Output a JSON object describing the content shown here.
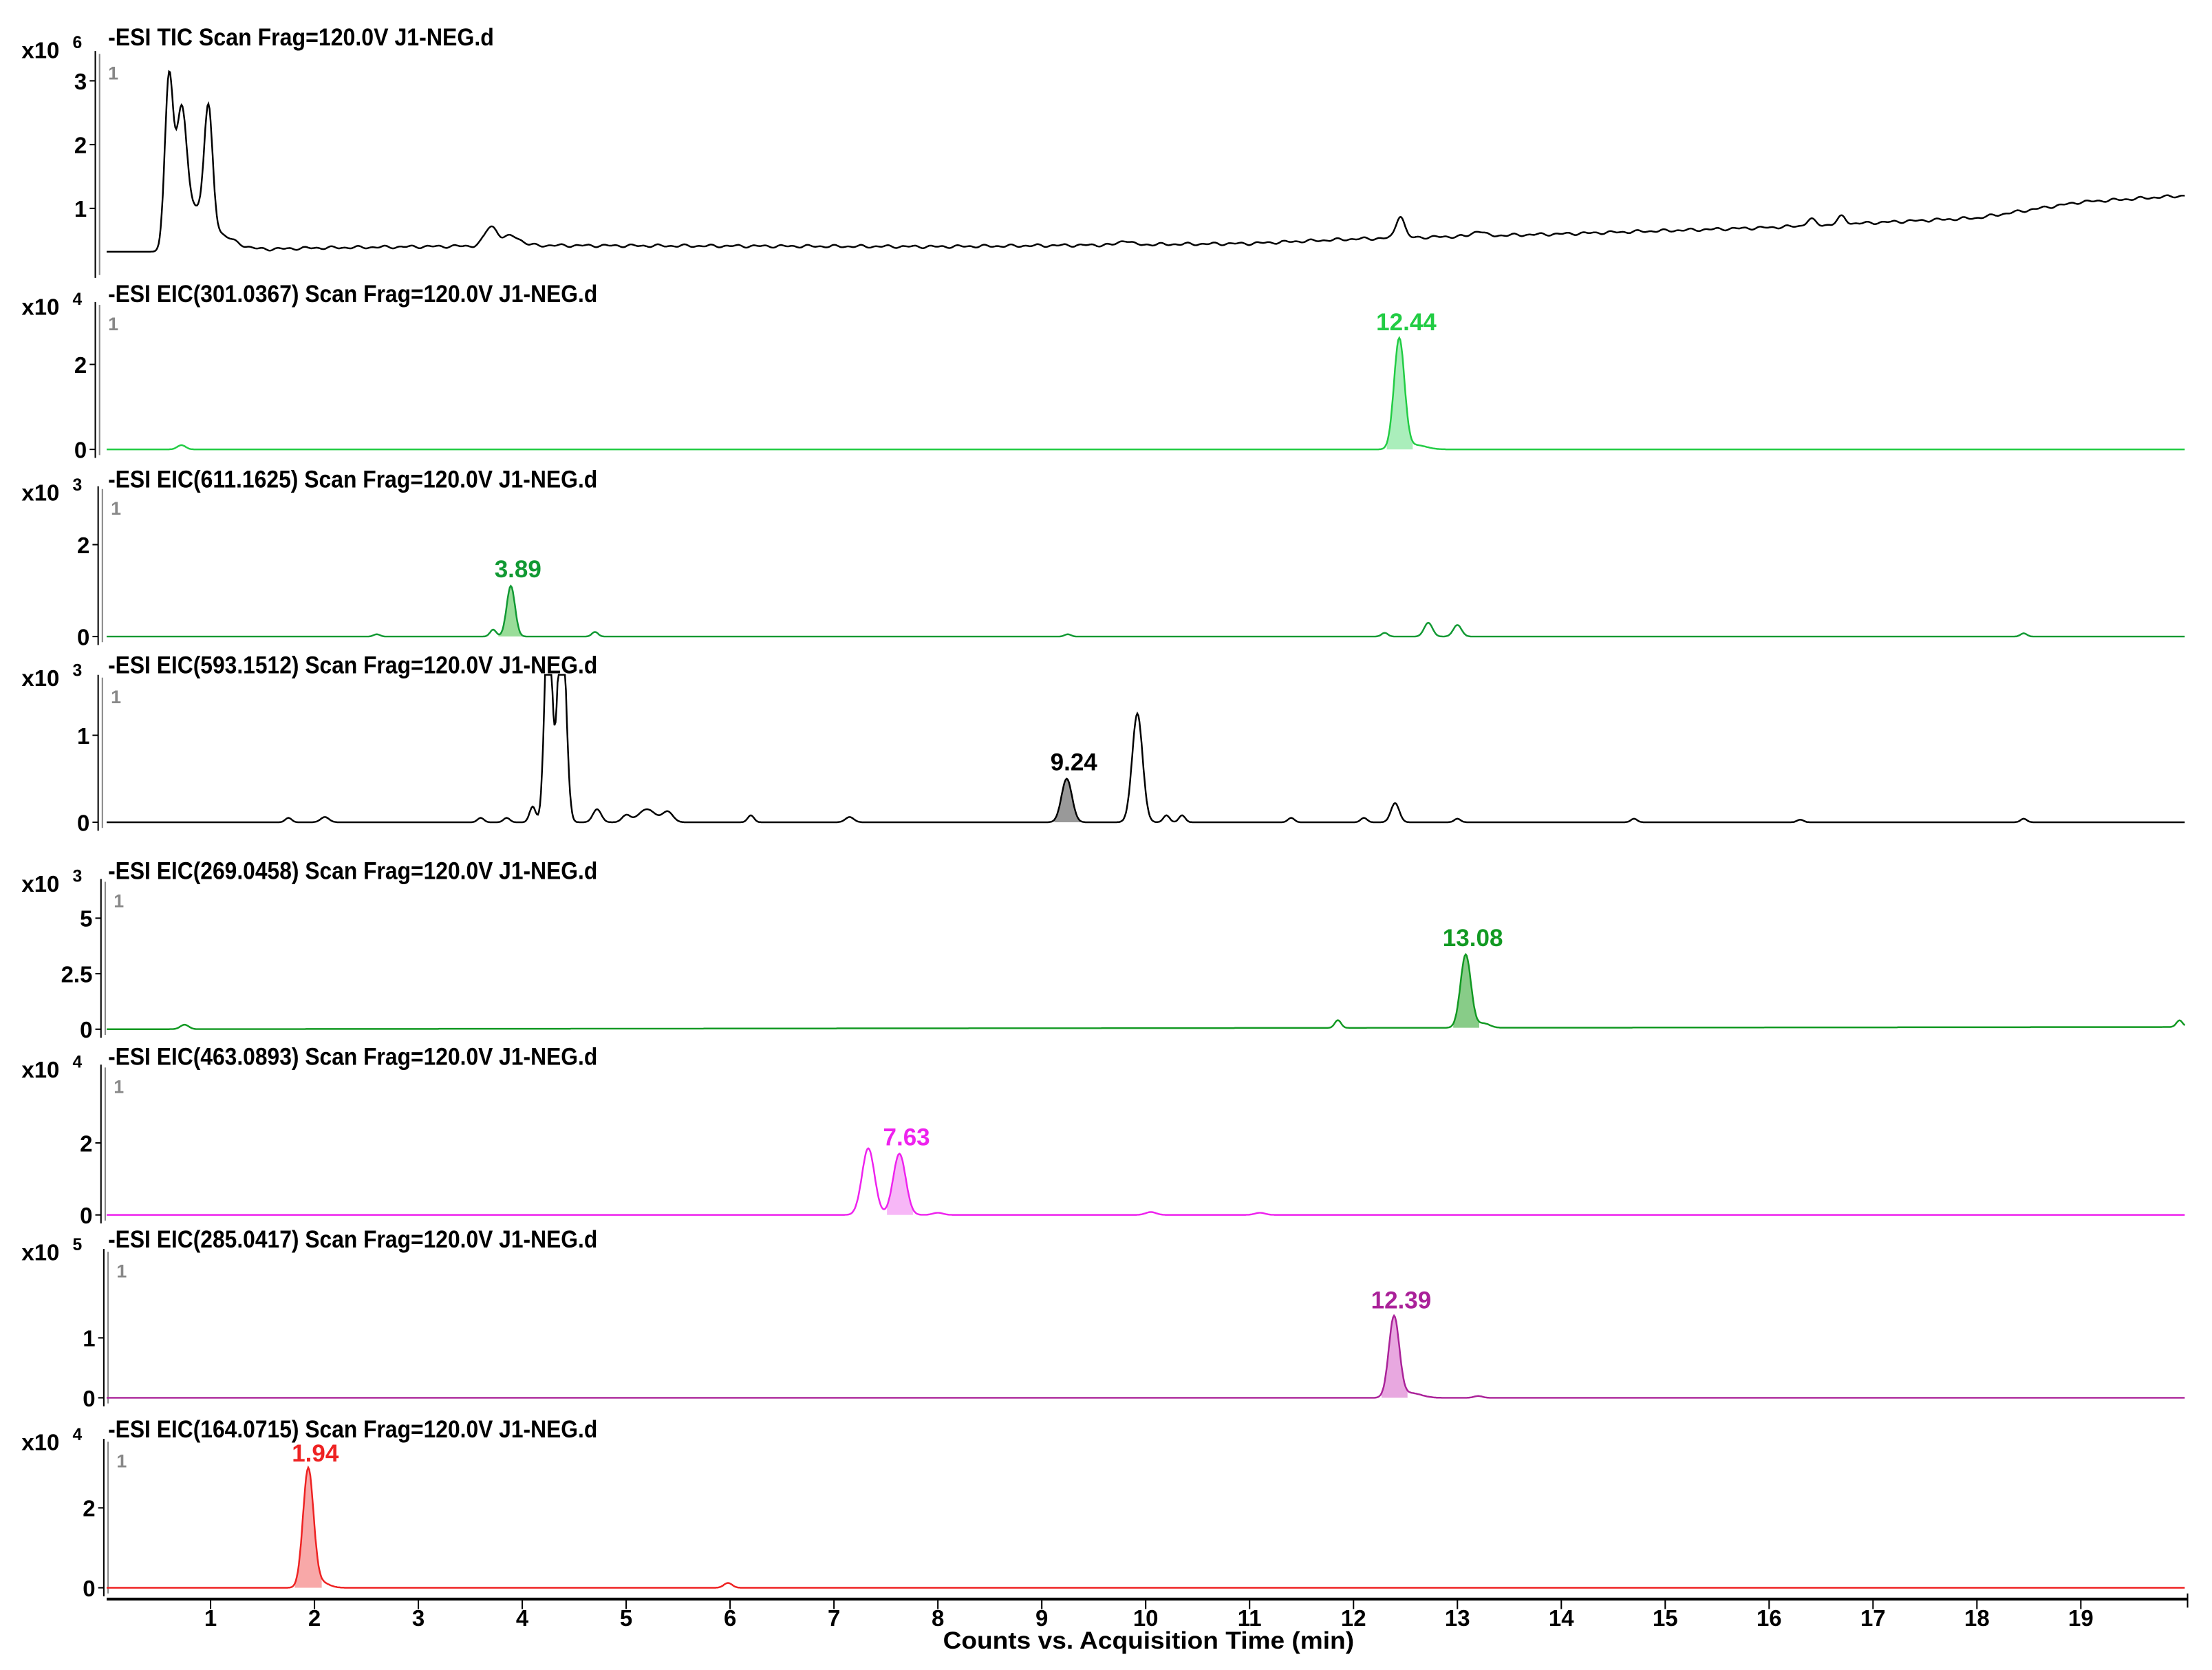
{
  "chart_data": {
    "type": "line",
    "xlabel": "Counts vs. Acquisition Time (min)",
    "xlim": [
      0,
      20
    ],
    "xticks": [
      "1",
      "2",
      "3",
      "4",
      "5",
      "6",
      "7",
      "8",
      "9",
      "10",
      "11",
      "12",
      "13",
      "14",
      "15",
      "16",
      "17",
      "18",
      "19"
    ],
    "panels": [
      {
        "title": "-ESI TIC Scan Frag=120.0V J1-NEG.d",
        "multiplier": "x10",
        "exponent": "6",
        "index_label": "1",
        "color": "#000000",
        "fill": "#bbbbbb",
        "ylim": [
          0,
          3.2
        ],
        "yticks": [
          "1",
          "2",
          "3"
        ],
        "ytick_values": [
          1,
          2,
          3
        ],
        "baseline": [
          [
            0,
            0.32
          ],
          [
            0.55,
            0.32
          ],
          [
            2,
            0.38
          ],
          [
            4,
            0.42
          ],
          [
            8,
            0.4
          ],
          [
            11,
            0.45
          ],
          [
            12,
            0.52
          ],
          [
            14,
            0.6
          ],
          [
            16,
            0.7
          ],
          [
            18,
            0.85
          ],
          [
            19,
            1.1
          ],
          [
            20,
            1.2
          ]
        ],
        "peaks": [
          [
            0.6,
            2.65,
            0.04
          ],
          [
            0.72,
            1.9,
            0.05
          ],
          [
            0.85,
            0.6,
            0.12
          ],
          [
            0.98,
            1.8,
            0.04
          ],
          [
            1.1,
            0.2,
            0.15
          ],
          [
            3.7,
            0.3,
            0.06
          ],
          [
            3.9,
            0.15,
            0.08
          ],
          [
            9.8,
            0.07,
            0.05
          ],
          [
            12.45,
            0.35,
            0.04
          ],
          [
            13.2,
            0.08,
            0.05
          ],
          [
            16.4,
            0.1,
            0.04
          ],
          [
            16.7,
            0.12,
            0.04
          ]
        ],
        "annotation": null
      },
      {
        "title": "-ESI EIC(301.0367) Scan Frag=120.0V J1-NEG.d",
        "multiplier": "x10",
        "exponent": "4",
        "index_label": "1",
        "color": "#22cc44",
        "fill": "#aaeebb",
        "ylim": [
          0,
          3.07
        ],
        "yticks": [
          "0",
          "2"
        ],
        "ytick_values": [
          0,
          2
        ],
        "baseline": [
          [
            0,
            0
          ],
          [
            20,
            0
          ]
        ],
        "peaks": [
          [
            0.72,
            0.1,
            0.04
          ],
          [
            12.44,
            2.6,
            0.05
          ],
          [
            12.6,
            0.1,
            0.1
          ]
        ],
        "annotation": {
          "label": "12.44",
          "x": 12.44,
          "color": "#22cc44",
          "shaded": 12.44
        }
      },
      {
        "title": "-ESI EIC(611.1625) Scan Frag=120.0V J1-NEG.d",
        "multiplier": "x10",
        "exponent": "3",
        "index_label": "1",
        "color": "#119933",
        "fill": "#99dd99",
        "ylim": [
          0,
          2.9
        ],
        "yticks": [
          "0",
          "2"
        ],
        "ytick_values": [
          0,
          2
        ],
        "baseline": [
          [
            0,
            0
          ],
          [
            20,
            0
          ]
        ],
        "peaks": [
          [
            2.6,
            0.05,
            0.03
          ],
          [
            3.72,
            0.15,
            0.03
          ],
          [
            3.89,
            1.1,
            0.04
          ],
          [
            4.7,
            0.1,
            0.03
          ],
          [
            9.25,
            0.05,
            0.03
          ],
          [
            12.3,
            0.08,
            0.03
          ],
          [
            12.72,
            0.3,
            0.04
          ],
          [
            13.0,
            0.25,
            0.04
          ],
          [
            18.45,
            0.07,
            0.03
          ]
        ],
        "annotation": {
          "label": "3.89",
          "x": 3.89,
          "color": "#119933",
          "shaded": 3.89
        }
      },
      {
        "title": "-ESI EIC(593.1512) Scan Frag=120.0V J1-NEG.d",
        "multiplier": "x10",
        "exponent": "3",
        "index_label": "1",
        "color": "#000000",
        "fill": "#999999",
        "ylim": [
          0,
          1.5
        ],
        "yticks": [
          "0",
          "1"
        ],
        "ytick_values": [
          0,
          1
        ],
        "baseline": [
          [
            0,
            0
          ],
          [
            20,
            0
          ]
        ],
        "peaks": [
          [
            1.75,
            0.05,
            0.03
          ],
          [
            2.1,
            0.06,
            0.04
          ],
          [
            3.6,
            0.05,
            0.03
          ],
          [
            3.85,
            0.05,
            0.03
          ],
          [
            4.1,
            0.18,
            0.03
          ],
          [
            4.25,
            2.5,
            0.035
          ],
          [
            4.38,
            2.5,
            0.04
          ],
          [
            4.72,
            0.15,
            0.04
          ],
          [
            5.0,
            0.08,
            0.04
          ],
          [
            5.2,
            0.15,
            0.08
          ],
          [
            5.4,
            0.12,
            0.05
          ],
          [
            6.2,
            0.08,
            0.03
          ],
          [
            7.15,
            0.06,
            0.04
          ],
          [
            9.24,
            0.5,
            0.05
          ],
          [
            9.92,
            1.25,
            0.05
          ],
          [
            10.2,
            0.08,
            0.03
          ],
          [
            10.35,
            0.08,
            0.03
          ],
          [
            11.4,
            0.05,
            0.03
          ],
          [
            12.1,
            0.05,
            0.03
          ],
          [
            12.4,
            0.22,
            0.04
          ],
          [
            13.0,
            0.04,
            0.03
          ],
          [
            14.7,
            0.04,
            0.03
          ],
          [
            16.3,
            0.03,
            0.03
          ],
          [
            18.45,
            0.04,
            0.03
          ]
        ],
        "annotation": {
          "label": "9.24",
          "x": 9.24,
          "color": "#000000",
          "shaded": 9.24
        }
      },
      {
        "title": "-ESI EIC(269.0458) Scan Frag=120.0V J1-NEG.d",
        "multiplier": "x10",
        "exponent": "3",
        "index_label": "1",
        "color": "#119922",
        "fill": "#88cc88",
        "ylim": [
          0,
          6
        ],
        "yticks": [
          "0",
          "2.5",
          "5"
        ],
        "ytick_values": [
          0,
          2.5,
          5
        ],
        "baseline": [
          [
            0,
            0
          ],
          [
            20,
            0.1
          ]
        ],
        "peaks": [
          [
            0.75,
            0.2,
            0.04
          ],
          [
            11.85,
            0.35,
            0.03
          ],
          [
            13.08,
            3.3,
            0.05
          ],
          [
            13.25,
            0.2,
            0.06
          ],
          [
            19.95,
            0.3,
            0.03
          ]
        ],
        "annotation": {
          "label": "13.08",
          "x": 13.08,
          "color": "#119922",
          "shaded": 13.08
        }
      },
      {
        "title": "-ESI EIC(463.0893) Scan Frag=120.0V J1-NEG.d",
        "multiplier": "x10",
        "exponent": "4",
        "index_label": "1",
        "color": "#ee22ee",
        "fill": "#f7b7f7",
        "ylim": [
          0,
          3.7
        ],
        "yticks": [
          "0",
          "2"
        ],
        "ytick_values": [
          0,
          2
        ],
        "baseline": [
          [
            0,
            0
          ],
          [
            20,
            0
          ]
        ],
        "peaks": [
          [
            7.33,
            1.85,
            0.06
          ],
          [
            7.63,
            1.7,
            0.06
          ],
          [
            8.0,
            0.06,
            0.05
          ],
          [
            10.05,
            0.08,
            0.05
          ],
          [
            11.1,
            0.06,
            0.05
          ]
        ],
        "annotation": {
          "label": "7.63",
          "x": 7.63,
          "color": "#ee22ee",
          "shaded": 7.63
        }
      },
      {
        "title": "-ESI EIC(285.0417) Scan Frag=120.0V J1-NEG.d",
        "multiplier": "x10",
        "exponent": "5",
        "index_label": "1",
        "color": "#aa2299",
        "fill": "#e8a8e0",
        "ylim": [
          0,
          2.2
        ],
        "yticks": [
          "0",
          "1"
        ],
        "ytick_values": [
          0,
          1
        ],
        "baseline": [
          [
            0,
            0
          ],
          [
            20,
            0
          ]
        ],
        "peaks": [
          [
            12.39,
            1.35,
            0.05
          ],
          [
            12.55,
            0.08,
            0.1
          ],
          [
            13.2,
            0.03,
            0.04
          ]
        ],
        "annotation": {
          "label": "12.39",
          "x": 12.39,
          "color": "#aa2299",
          "shaded": 12.39
        }
      },
      {
        "title": "-ESI EIC(164.0715) Scan Frag=120.0V J1-NEG.d",
        "multiplier": "x10",
        "exponent": "4",
        "index_label": "1",
        "color": "#ee2222",
        "fill": "#f8a8a8",
        "ylim": [
          0,
          3.3
        ],
        "yticks": [
          "0",
          "2"
        ],
        "ytick_values": [
          0,
          2
        ],
        "baseline": [
          [
            0,
            0
          ],
          [
            20,
            0
          ]
        ],
        "peaks": [
          [
            1.94,
            2.95,
            0.05
          ],
          [
            2.05,
            0.15,
            0.08
          ],
          [
            5.98,
            0.12,
            0.04
          ]
        ],
        "annotation": {
          "label": "1.94",
          "x": 1.94,
          "color": "#ee2222",
          "shaded": 1.94
        }
      }
    ]
  }
}
